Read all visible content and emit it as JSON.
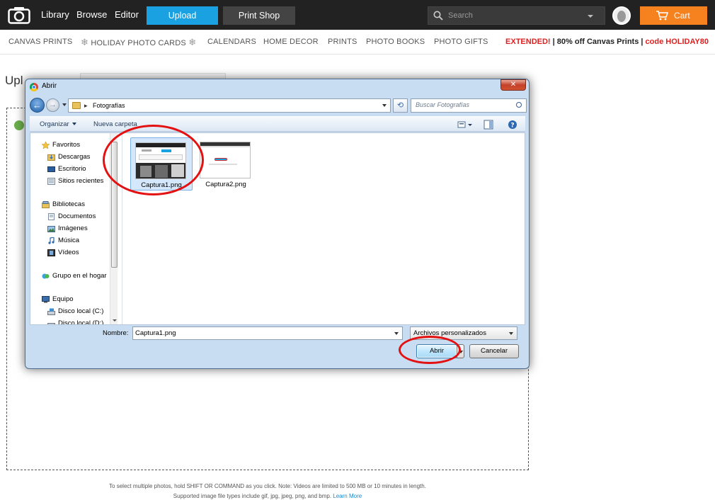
{
  "topbar": {
    "nav": [
      "Library",
      "Browse",
      "Editor"
    ],
    "upload_label": "Upload",
    "printshop_label": "Print Shop",
    "search_placeholder": "Search",
    "cart_label": "Cart"
  },
  "subnav": {
    "items": [
      "CANVAS PRINTS",
      "HOLIDAY PHOTO CARDS",
      "CALENDARS",
      "HOME DECOR",
      "PRINTS",
      "PHOTO BOOKS",
      "PHOTO GIFTS"
    ],
    "promo_extended": "EXTENDED!",
    "promo_sep": " | ",
    "promo_offer": "80% off Canvas Prints",
    "promo_sep2": " | ",
    "promo_code": "code HOLIDAY80"
  },
  "page": {
    "title": "Upl",
    "footnote1": "To select multiple photos, hold SHIFT OR COMMAND as you click. Note: Videos are limited to 500 MB or 10 minutes in length.",
    "footnote2": "Supported image file types include gif, jpg, jpeg, png, and bmp.",
    "learn_more": "Learn More"
  },
  "dialog": {
    "title": "Abrir",
    "close_glyph": "✕",
    "path": "Fotografías",
    "search_placeholder": "Buscar Fotografías",
    "toolbar": {
      "organize": "Organizar",
      "new_folder": "Nueva carpeta"
    },
    "nav": {
      "favorites": "Favoritos",
      "downloads": "Descargas",
      "desktop": "Escritorio",
      "recent": "Sitios recientes",
      "libraries": "Bibliotecas",
      "documents": "Documentos",
      "images": "Imágenes",
      "music": "Música",
      "videos": "Vídeos",
      "homegroup": "Grupo en el hogar",
      "computer": "Equipo",
      "local_c": "Disco local (C:)",
      "local_d": "Disco local (D:)"
    },
    "files": [
      {
        "name": "Captura1.png",
        "selected": true
      },
      {
        "name": "Captura2.png",
        "selected": false
      }
    ],
    "filename_label": "Nombre:",
    "filename_value": "Captura1.png",
    "filetype": "Archivos personalizados",
    "open_label": "Abrir",
    "cancel_label": "Cancelar"
  },
  "colors": {
    "upload_blue": "#1aa1e1",
    "cart_orange": "#f5811f",
    "promo_red": "#e01f1f",
    "annotation_red": "#e31111"
  }
}
